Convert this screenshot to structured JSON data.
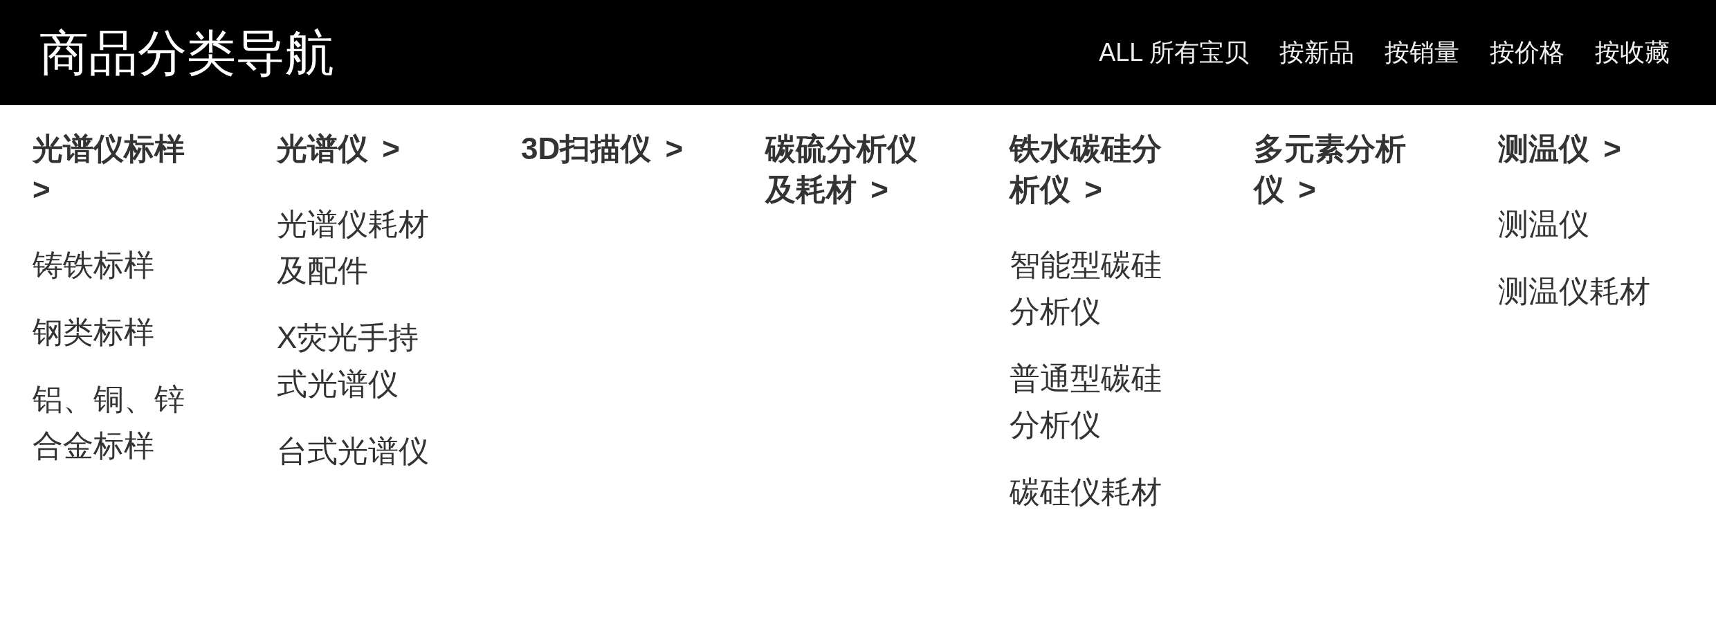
{
  "header": {
    "title": "商品分类导航",
    "nav_links": [
      "ALL 所有宝贝",
      "按新品",
      "按销量",
      "按价格",
      "按收藏"
    ]
  },
  "categories": [
    {
      "title": "光谱仪标样 >",
      "items": [
        "铸铁标样",
        "钢类标样",
        "铝、铜、锌合金标样"
      ]
    },
    {
      "title": "光谱仪 >",
      "items": [
        "光谱仪耗材及配件",
        "X荧光手持式光谱仪",
        "台式光谱仪"
      ]
    },
    {
      "title": "3D扫描仪 >"
    },
    {
      "title": "碳硫分析仪及耗材 >"
    },
    {
      "title": "铁水碳硅分析仪 >",
      "items": [
        "智能型碳硅分析仪",
        "普通型碳硅分析仪",
        "碳硅仪耗材"
      ]
    },
    {
      "title": "多元素分析仪 >"
    },
    {
      "title": "测温仪 >",
      "items": [
        "测温仪",
        "测温仪耗材"
      ]
    }
  ]
}
